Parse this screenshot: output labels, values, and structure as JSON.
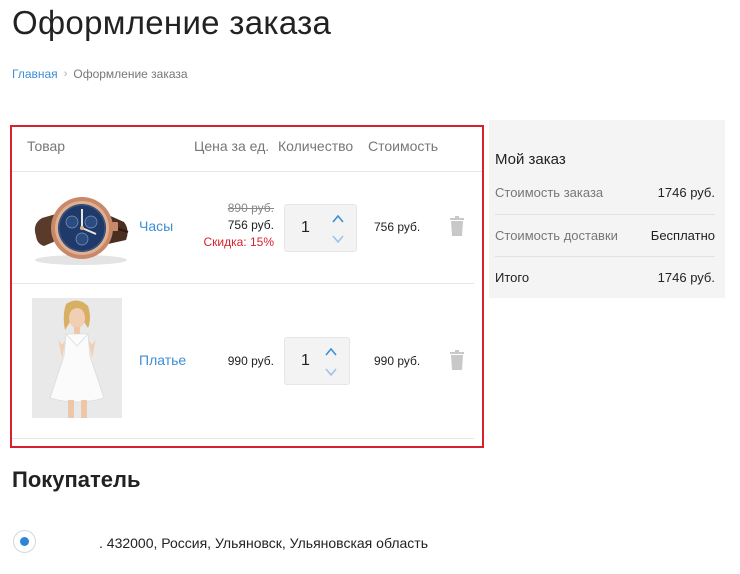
{
  "page": {
    "title": "Оформление заказа"
  },
  "breadcrumb": {
    "home": "Главная",
    "current": "Оформление заказа"
  },
  "cart": {
    "columns": {
      "product": "Товар",
      "price": "Цена за ед.",
      "qty": "Количество",
      "cost": "Стоимость"
    },
    "items": [
      {
        "name": "Часы",
        "old_price": "890 руб.",
        "price": "756 руб.",
        "discount": "Скидка: 15%",
        "qty": "1",
        "cost": "756 руб.",
        "image_icon": "wristwatch-image"
      },
      {
        "name": "Платье",
        "price": "990 руб.",
        "qty": "1",
        "cost": "990 руб.",
        "image_icon": "white-dress-model-image"
      }
    ]
  },
  "summary": {
    "title": "Мой заказ",
    "order_cost_label": "Стоимость заказа",
    "order_cost": "1746 руб.",
    "delivery_label": "Стоимость доставки",
    "delivery": "Бесплатно",
    "total_label": "Итого",
    "total": "1746 руб."
  },
  "buyer": {
    "title": "Покупатель",
    "address": ". 432000, Россия, Ульяновск, Ульяновская область"
  },
  "colors": {
    "accent": "#3c8fd6",
    "highlight_border": "#d6222d",
    "discount": "#d6222d",
    "summary_bg": "#f4f4f4"
  }
}
